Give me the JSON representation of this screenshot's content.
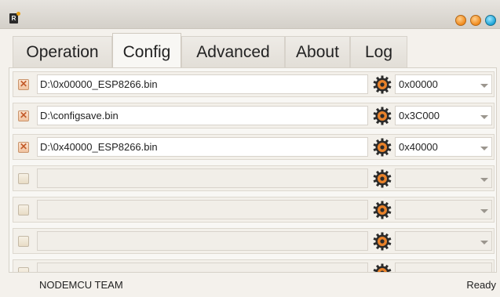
{
  "window": {
    "app_icon_label": "R",
    "buttons": [
      "minimize",
      "maximize",
      "close"
    ]
  },
  "tabs": [
    {
      "label": "Operation",
      "active": false
    },
    {
      "label": "Config",
      "active": true
    },
    {
      "label": "Advanced",
      "active": false
    },
    {
      "label": "About",
      "active": false
    },
    {
      "label": "Log",
      "active": false
    }
  ],
  "config_rows": [
    {
      "checked": true,
      "path": "D:\\0x00000_ESP8266.bin",
      "address": "0x00000"
    },
    {
      "checked": true,
      "path": "D:\\configsave.bin",
      "address": "0x3C000"
    },
    {
      "checked": true,
      "path": "D:\\0x40000_ESP8266.bin",
      "address": "0x40000"
    },
    {
      "checked": false,
      "path": "",
      "address": ""
    },
    {
      "checked": false,
      "path": "",
      "address": ""
    },
    {
      "checked": false,
      "path": "",
      "address": ""
    },
    {
      "checked": false,
      "path": "",
      "address": ""
    }
  ],
  "status": {
    "left": "NODEMCU TEAM",
    "right": "Ready"
  },
  "colors": {
    "accent_orange": "#f08a1c",
    "close_blue": "#1aa3d6",
    "checkmark": "#c25a2a"
  }
}
